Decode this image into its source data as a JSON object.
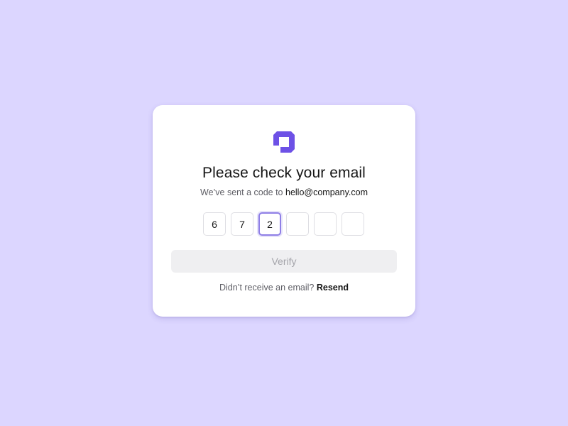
{
  "colors": {
    "background": "#dcd6ff",
    "brand": "#6d51e6",
    "focus_ring": "#8f7fe6"
  },
  "logo": {
    "icon": "brand-logo-icon"
  },
  "title": "Please check your email",
  "subtitle": {
    "prefix": "We’ve sent a code to",
    "email": "hello@company.com"
  },
  "otp": {
    "digits": [
      "6",
      "7",
      "2",
      "",
      "",
      ""
    ],
    "active_index": 2
  },
  "verify_button": {
    "label": "Verify",
    "disabled": true
  },
  "resend": {
    "prompt": "Didn’t receive an email?",
    "link": "Resend"
  }
}
